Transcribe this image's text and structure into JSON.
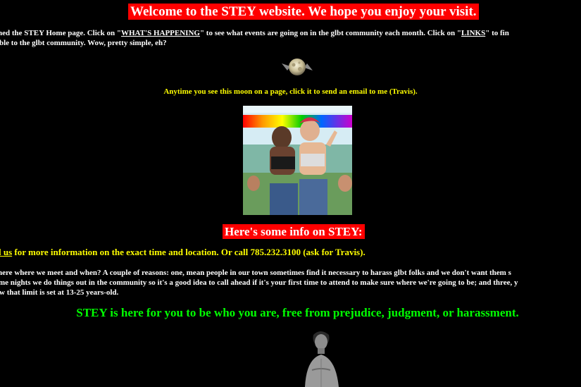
{
  "welcome": "Welcome to the STEY website. We hope you enjoy your visit.",
  "intro": {
    "line1_pre": "hed the STEY Home page. Click on \"",
    "whats_happening": "WHAT'S HAPPENING",
    "line1_mid": "\" to see what events are going on in the glbt community each month. Click on \"",
    "links": "LINKS",
    "line1_post": "\" to fin",
    "line2": "ble to the glbt community. Wow, pretty simple, eh?"
  },
  "moon": {
    "icon": "moon-icon",
    "caption": "Anytime you see this moon on a page, click it to send an email to me (Travis)."
  },
  "info_heading": "Here's some info on STEY:",
  "contact": {
    "link": "l us",
    "text": " for more information on the exact time and location. Or call 785.232.3100 (ask for Travis)."
  },
  "why": {
    "line1": " here where we meet and when? A couple of reasons: one, mean people in our town sometimes find it necessary to harass glbt folks and we don't want them s",
    "line2": "me nights we do things out in the community so it's a good idea to call ahead if it's your first time to attend to make sure where we're going to be; and three, y",
    "line3": "w that limit is set at 13-25 years-old."
  },
  "tagline": "STEY is here for you to be who you are, free from prejudice, judgment, or harassment.",
  "colors": {
    "banner": "#ff0000",
    "yellow": "#ffff00",
    "green": "#00ff00",
    "background": "#000000"
  }
}
